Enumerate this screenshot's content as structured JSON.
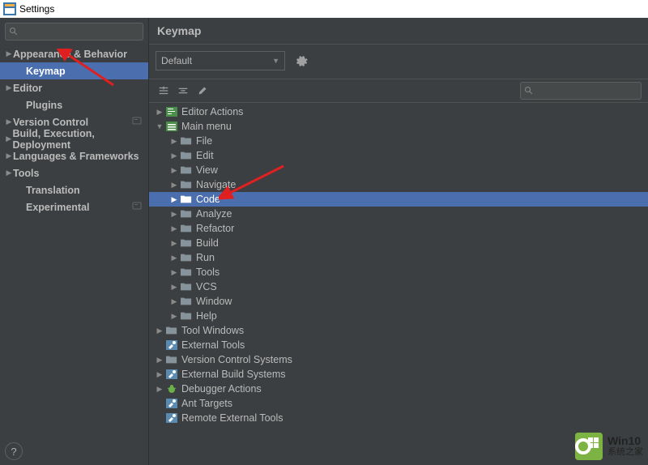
{
  "window_title": "Settings",
  "sidebar": {
    "items": [
      {
        "label": "Appearance & Behavior",
        "level": 1,
        "expand": true
      },
      {
        "label": "Keymap",
        "level": 2,
        "selected": true
      },
      {
        "label": "Editor",
        "level": 1,
        "expand": true
      },
      {
        "label": "Plugins",
        "level": 2
      },
      {
        "label": "Version Control",
        "level": 1,
        "expand": true,
        "proj": true
      },
      {
        "label": "Build, Execution, Deployment",
        "level": 1,
        "expand": true
      },
      {
        "label": "Languages & Frameworks",
        "level": 1,
        "expand": true
      },
      {
        "label": "Tools",
        "level": 1,
        "expand": true
      },
      {
        "label": "Translation",
        "level": 2
      },
      {
        "label": "Experimental",
        "level": 2,
        "proj": true
      }
    ]
  },
  "content": {
    "title": "Keymap",
    "scheme_combo": "Default"
  },
  "tree": [
    {
      "label": "Editor Actions",
      "indent": 0,
      "icon": "editor",
      "arrow": "r"
    },
    {
      "label": "Main menu",
      "indent": 0,
      "icon": "menu",
      "arrow": "d"
    },
    {
      "label": "File",
      "indent": 1,
      "icon": "folder",
      "arrow": "r"
    },
    {
      "label": "Edit",
      "indent": 1,
      "icon": "folder",
      "arrow": "r"
    },
    {
      "label": "View",
      "indent": 1,
      "icon": "folder",
      "arrow": "r"
    },
    {
      "label": "Navigate",
      "indent": 1,
      "icon": "folder",
      "arrow": "r"
    },
    {
      "label": "Code",
      "indent": 1,
      "icon": "folder",
      "arrow": "r",
      "selected": true
    },
    {
      "label": "Analyze",
      "indent": 1,
      "icon": "folder",
      "arrow": "r"
    },
    {
      "label": "Refactor",
      "indent": 1,
      "icon": "folder",
      "arrow": "r"
    },
    {
      "label": "Build",
      "indent": 1,
      "icon": "folder",
      "arrow": "r"
    },
    {
      "label": "Run",
      "indent": 1,
      "icon": "folder",
      "arrow": "r"
    },
    {
      "label": "Tools",
      "indent": 1,
      "icon": "folder",
      "arrow": "r"
    },
    {
      "label": "VCS",
      "indent": 1,
      "icon": "folder",
      "arrow": "r"
    },
    {
      "label": "Window",
      "indent": 1,
      "icon": "folder",
      "arrow": "r"
    },
    {
      "label": "Help",
      "indent": 1,
      "icon": "folder",
      "arrow": "r"
    },
    {
      "label": "Tool Windows",
      "indent": 0,
      "icon": "folder",
      "arrow": "r"
    },
    {
      "label": "External Tools",
      "indent": 0,
      "icon": "tools",
      "arrow": ""
    },
    {
      "label": "Version Control Systems",
      "indent": 0,
      "icon": "folder",
      "arrow": "r"
    },
    {
      "label": "External Build Systems",
      "indent": 0,
      "icon": "tools",
      "arrow": "r"
    },
    {
      "label": "Debugger Actions",
      "indent": 0,
      "icon": "bug",
      "arrow": "r"
    },
    {
      "label": "Ant Targets",
      "indent": 0,
      "icon": "tools",
      "arrow": ""
    },
    {
      "label": "Remote External Tools",
      "indent": 0,
      "icon": "tools",
      "arrow": ""
    }
  ],
  "watermark": {
    "line1": "Win10",
    "line2": "系统之家"
  },
  "help_label": "?"
}
